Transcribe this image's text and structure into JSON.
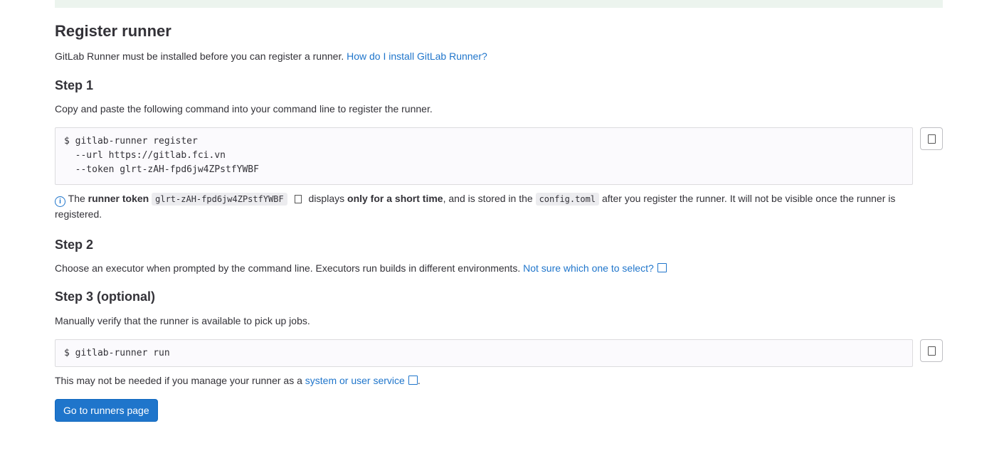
{
  "title": "Register runner",
  "intro": {
    "text": "GitLab Runner must be installed before you can register a runner.",
    "link": "How do I install GitLab Runner?"
  },
  "step1": {
    "heading": "Step 1",
    "desc": "Copy and paste the following command into your command line to register the runner.",
    "command": [
      "$ gitlab-runner register",
      "  --url https://gitlab.fci.vn",
      "  --token glrt-zAH-fpd6jw4ZPstfYWBF"
    ],
    "note": {
      "prefix": "The",
      "bold1": "runner token",
      "token": "glrt-zAH-fpd6jw4ZPstfYWBF",
      "mid": "displays",
      "bold2": "only for a short time",
      "mid2": ", and is stored in the",
      "file": "config.toml",
      "suffix": "after you register the runner. It will not be visible once the runner is registered."
    }
  },
  "step2": {
    "heading": "Step 2",
    "desc": "Choose an executor when prompted by the command line. Executors run builds in different environments.",
    "link": "Not sure which one to select?"
  },
  "step3": {
    "heading": "Step 3 (optional)",
    "desc": "Manually verify that the runner is available to pick up jobs.",
    "command": "$ gitlab-runner run",
    "note": "This may not be needed if you manage your runner as a",
    "link": "system or user service",
    "end": "."
  },
  "button": "Go to runners page"
}
